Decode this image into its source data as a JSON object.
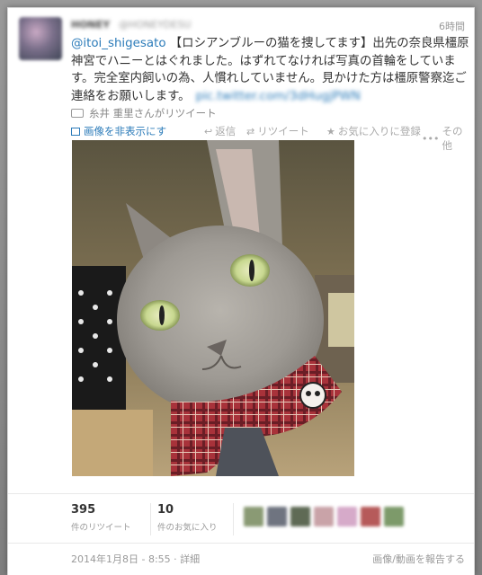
{
  "tweet": {
    "display_name": "HONEY",
    "screen_name": "@HONEYDESU",
    "time": "6時間",
    "mention": "@itoi_shigesato",
    "text": " 【ロシアンブルーの猫を捜してます】出先の奈良県橿原神宮でハニーとはぐれました。はずれてなければ写真の首輪をしています。完全室内飼いの為、人慣れしていません。見かけた方は橿原警察迄ご連絡をお願いします。",
    "link": "pic.twitter.com/3dHugjPWN",
    "retweeted_by": "糸井 重里さんがリツイート",
    "hide_media": "画像を非表示にす",
    "actions": {
      "reply": "返信",
      "retweet": "リツイート",
      "favorite": "お気に入りに登録",
      "more": "その他"
    },
    "icons": {
      "retweeted": "retweet-icon",
      "media": "image-icon",
      "reply": "reply-arrow-icon",
      "retweet": "retweet-icon",
      "favorite": "star-icon",
      "more": "ellipsis-icon"
    }
  },
  "stats": {
    "retweets_count": "395",
    "retweets_label": "件のリツイート",
    "favorites_count": "10",
    "favorites_label": "件のお気に入り",
    "avatar_colors": [
      "#8a9a74",
      "#6f7480",
      "#5f6a55",
      "#c9a3a8",
      "#d6aac9",
      "#b65a5a",
      "#7d9a6a"
    ]
  },
  "footer": {
    "date": "2014年1月8日 - 8:55 · 詳細",
    "report": "画像/動画を報告する"
  },
  "colors": {
    "link": "#2b7bb9",
    "muted": "#999999",
    "text": "#333333"
  }
}
